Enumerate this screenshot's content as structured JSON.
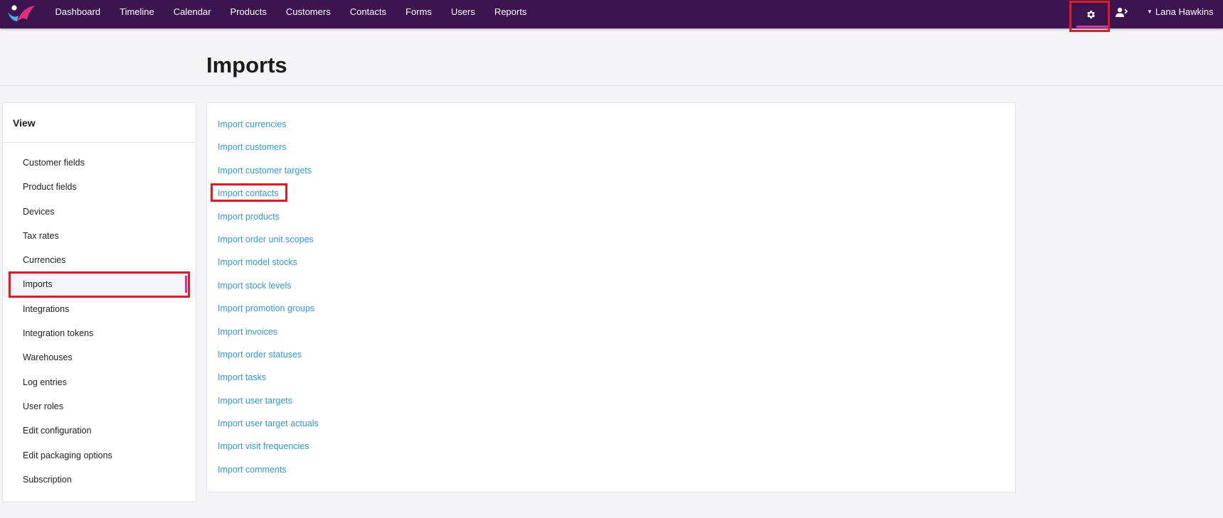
{
  "nav": {
    "items": [
      "Dashboard",
      "Timeline",
      "Calendar",
      "Products",
      "Customers",
      "Contacts",
      "Forms",
      "Users",
      "Reports"
    ],
    "user_name": "Lana Hawkins"
  },
  "icons": {
    "logo": "app-logo",
    "settings": "gear-icon",
    "switch_user": "user-switch-icon",
    "user_menu_caret": "caret-down-icon"
  },
  "colors": {
    "topbar": "#3c1450",
    "link": "#2e9ad6",
    "highlight": "#e01b24",
    "active_accent": "#c23aa8"
  },
  "page": {
    "title": "Imports"
  },
  "sidebar": {
    "heading": "View",
    "items": [
      {
        "label": "Customer fields"
      },
      {
        "label": "Product fields"
      },
      {
        "label": "Devices"
      },
      {
        "label": "Tax rates"
      },
      {
        "label": "Currencies"
      },
      {
        "label": "Imports",
        "active": true
      },
      {
        "label": "Integrations"
      },
      {
        "label": "Integration tokens"
      },
      {
        "label": "Warehouses"
      },
      {
        "label": "Log entries"
      },
      {
        "label": "User roles"
      },
      {
        "label": "Edit configuration"
      },
      {
        "label": "Edit packaging options"
      },
      {
        "label": "Subscription"
      }
    ]
  },
  "imports": {
    "links": [
      "Import currencies",
      "Import customers",
      "Import customer targets",
      "Import contacts",
      "Import products",
      "Import order unit scopes",
      "Import model stocks",
      "Import stock levels",
      "Import promotion groups",
      "Import invoices",
      "Import order statuses",
      "Import tasks",
      "Import user targets",
      "Import user target actuals",
      "Import visit frequencies",
      "Import comments"
    ]
  }
}
